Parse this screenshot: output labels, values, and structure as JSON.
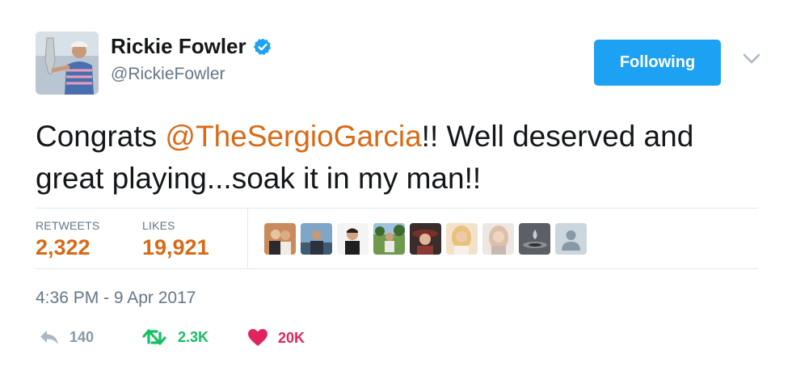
{
  "user": {
    "name": "Rickie Fowler",
    "handle": "@RickieFowler",
    "verified": true,
    "avatar_icon": "profile-photo-golfer-with-trophy"
  },
  "follow_button": {
    "label": "Following",
    "color": "#1da1f2"
  },
  "menu": {
    "icon": "chevron-down-icon"
  },
  "tweet": {
    "text_before": "Congrats ",
    "mention": "@TheSergioGarcia",
    "text_after": "!! Well deserved and great playing...soak it in my man!!",
    "mention_color": "#d86a17"
  },
  "stats": {
    "retweets_label": "RETWEETS",
    "retweets_value": "2,322",
    "likes_label": "LIKES",
    "likes_value": "19,921",
    "value_color": "#d86a17"
  },
  "likers": [
    {
      "icon": "liker-avatar-couple"
    },
    {
      "icon": "liker-avatar-man-waterfront"
    },
    {
      "icon": "liker-avatar-man-portrait"
    },
    {
      "icon": "liker-avatar-golf-course"
    },
    {
      "icon": "liker-avatar-woman-hat"
    },
    {
      "icon": "liker-avatar-blonde-woman"
    },
    {
      "icon": "liker-avatar-woman-selfie"
    },
    {
      "icon": "liker-avatar-water-drop"
    },
    {
      "icon": "liker-avatar-default"
    }
  ],
  "timestamp": "4:36 PM - 9 Apr 2017",
  "actions": {
    "reply_count": "140",
    "retweet_count": "2.3K",
    "like_count": "20K",
    "reply_color": "#8899a6",
    "retweet_color": "#17bf63",
    "like_color": "#e0245e"
  }
}
